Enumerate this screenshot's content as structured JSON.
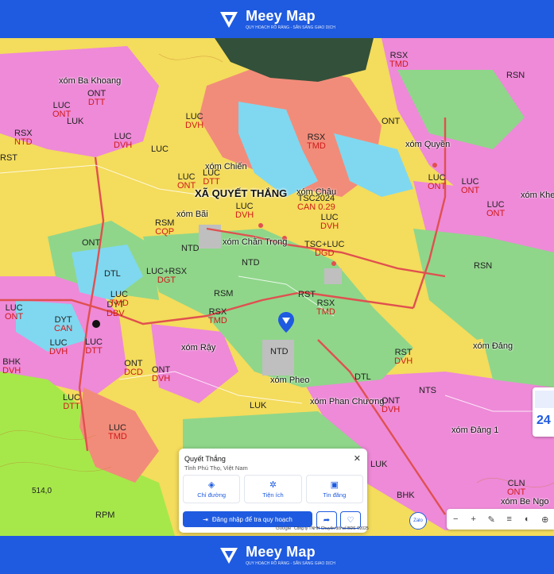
{
  "brand": {
    "name": "Meey Map",
    "tagline": "QUY HOẠCH RÕ RÀNG - SẴN SÀNG GIAO DỊCH",
    "color": "#1f5be0"
  },
  "map": {
    "commune": "XÃ QUYẾT THẮNG",
    "places": [
      {
        "id": "ba-khoang",
        "text": "xóm Ba Khoang"
      },
      {
        "id": "chien",
        "text": "xóm Chiến"
      },
      {
        "id": "chau",
        "text": "xóm Châu"
      },
      {
        "id": "bai",
        "text": "xóm Bãi"
      },
      {
        "id": "chan-trong",
        "text": "xóm Chằn Trọng"
      },
      {
        "id": "quyen",
        "text": "xóm Quyền"
      },
      {
        "id": "ray",
        "text": "xóm Rậy"
      },
      {
        "id": "pheo",
        "text": "xóm Pheo"
      },
      {
        "id": "phan-chuong",
        "text": "xóm Phan Chương"
      },
      {
        "id": "dang",
        "text": "xóm Đảng"
      },
      {
        "id": "dang1",
        "text": "xóm Đảng 1"
      },
      {
        "id": "khe",
        "text": "xóm Khe"
      },
      {
        "id": "be-ngo",
        "text": "xóm Be Ngo"
      }
    ],
    "labels": [
      {
        "id": "l1",
        "code": "ONT",
        "sub": "DTT"
      },
      {
        "id": "l2",
        "code": "LUC",
        "sub": "ONT"
      },
      {
        "id": "l3",
        "code": "LUK",
        "sub": ""
      },
      {
        "id": "l4",
        "code": "LUC",
        "sub": "DVH"
      },
      {
        "id": "l5",
        "code": "LUC",
        "sub": "DVH"
      },
      {
        "id": "l6",
        "code": "LUC",
        "sub": ""
      },
      {
        "id": "l7",
        "code": "LUC",
        "sub": "ONT"
      },
      {
        "id": "l8",
        "code": "RSX",
        "sub": "NTD"
      },
      {
        "id": "l9",
        "code": "RST",
        "sub": ""
      },
      {
        "id": "l10",
        "code": "LUC",
        "sub": "DTT"
      },
      {
        "id": "l11",
        "code": "LUC",
        "sub": "DVH"
      },
      {
        "id": "l12",
        "code": "RSM",
        "sub": "CQP"
      },
      {
        "id": "l13",
        "code": "NTD",
        "sub": ""
      },
      {
        "id": "l14",
        "code": "ONT",
        "sub": ""
      },
      {
        "id": "l15",
        "code": "DTL",
        "sub": ""
      },
      {
        "id": "l16",
        "code": "LUC+RSX",
        "sub": "DGT"
      },
      {
        "id": "l17",
        "code": "DYT",
        "sub": "DBV"
      },
      {
        "id": "l18",
        "code": "RSM",
        "sub": ""
      },
      {
        "id": "l19",
        "code": "RSX",
        "sub": "TMD"
      },
      {
        "id": "l20",
        "code": "RSX",
        "sub": "TMD"
      },
      {
        "id": "l21",
        "code": "TSC2024",
        "sub": "CAN 0.29"
      },
      {
        "id": "l22",
        "code": "LUC",
        "sub": "DVH"
      },
      {
        "id": "l23",
        "code": "TSC+LUC",
        "sub": "DGD"
      },
      {
        "id": "l24",
        "code": "NTD",
        "sub": ""
      },
      {
        "id": "l25",
        "code": "RST",
        "sub": ""
      },
      {
        "id": "l26",
        "code": "RSX",
        "sub": "TMD"
      },
      {
        "id": "l27",
        "code": "RSX",
        "sub": "TMD"
      },
      {
        "id": "l28",
        "code": "ONT",
        "sub": "DVH"
      },
      {
        "id": "l29",
        "code": "LUC",
        "sub": "DTT"
      },
      {
        "id": "l30",
        "code": "LUC",
        "sub": "TMD"
      },
      {
        "id": "l31",
        "code": "RSN",
        "sub": ""
      },
      {
        "id": "l32",
        "code": "RST",
        "sub": "DVH"
      },
      {
        "id": "l33",
        "code": "NTS",
        "sub": ""
      },
      {
        "id": "l34",
        "code": "ONT",
        "sub": "DVH"
      },
      {
        "id": "l35",
        "code": "BHK",
        "sub": ""
      },
      {
        "id": "l36",
        "code": "LUK",
        "sub": ""
      },
      {
        "id": "l37",
        "code": "CLN",
        "sub": "ONT"
      },
      {
        "id": "l38",
        "code": "RPM",
        "sub": ""
      },
      {
        "id": "l39",
        "code": "LUC",
        "sub": "ONT"
      },
      {
        "id": "l40",
        "code": "LUC",
        "sub": "ONT"
      },
      {
        "id": "l41",
        "code": "RSN",
        "sub": ""
      },
      {
        "id": "l42",
        "code": "DTL",
        "sub": ""
      },
      {
        "id": "l43",
        "code": "ONT",
        "sub": "DCD"
      },
      {
        "id": "l44",
        "code": "BHK",
        "sub": "DVH"
      },
      {
        "id": "l45",
        "code": "LUC",
        "sub": "DTT"
      },
      {
        "id": "l46",
        "code": "LUC",
        "sub": "TMD"
      },
      {
        "id": "l47",
        "code": "DYT",
        "sub": "CAN"
      },
      {
        "id": "l48",
        "code": "LUC",
        "sub": "DVH"
      },
      {
        "id": "l49",
        "code": "LUC",
        "sub": "ONT"
      },
      {
        "id": "l50",
        "code": "LUC",
        "sub": "ONT"
      },
      {
        "id": "l51",
        "code": "ONT",
        "sub": ""
      },
      {
        "id": "l52",
        "code": "LUK",
        "sub": ""
      }
    ],
    "elevation": "514,0",
    "grey_tag": "NTD"
  },
  "popup": {
    "title": "Quyết Thắng",
    "subtitle": "Tỉnh Phú Thọ, Việt Nam",
    "close": "✕",
    "actions": [
      {
        "label": "Chỉ đường",
        "icon": "directions-icon"
      },
      {
        "label": "Tiện ích",
        "icon": "utilities-icon"
      },
      {
        "label": "Tin đăng",
        "icon": "listing-icon"
      }
    ],
    "login_label": "Đăng nhập để tra quy hoạch",
    "attribution": "Công ty TNHH Chuyển đổi số BĐS ©2025",
    "google": "Google"
  },
  "side_panel": {
    "number": "24"
  },
  "zalo": "Zalo",
  "colors": {
    "yellow": "#f4dc5c",
    "pink": "#ee8ad8",
    "green": "#8fd68a",
    "salmon": "#f28c7a",
    "cyan": "#7fd8f0",
    "grey": "#bfbfbf",
    "lime": "#a6e84a",
    "red": "#d01a1a"
  }
}
